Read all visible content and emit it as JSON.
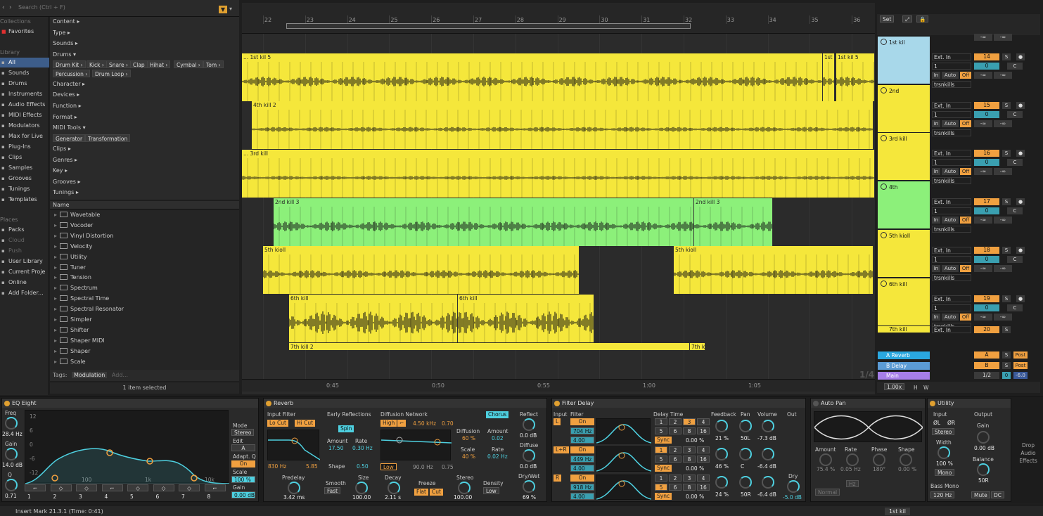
{
  "browser": {
    "search_placeholder": "Search (Ctrl + F)",
    "collections_header": "Collections",
    "favorites": "Favorites",
    "library_header": "Library",
    "library": [
      "All",
      "Sounds",
      "Drums",
      "Instruments",
      "Audio Effects",
      "MIDI Effects",
      "Modulators",
      "Max for Live",
      "Plug-Ins",
      "Clips",
      "Samples",
      "Grooves",
      "Tunings",
      "Templates"
    ],
    "places_header": "Places",
    "places": [
      "Packs",
      "Cloud",
      "Push",
      "User Library",
      "Current Proje",
      "Online",
      "Add Folder..."
    ],
    "filters": {
      "content": "Content ▸",
      "type": "Type ▸",
      "sounds": "Sounds ▸",
      "drums": "Drums ▾",
      "drum_chips": [
        "Drum Kit ›",
        "Kick ›",
        "Snare ›",
        "Clap",
        "Hihat ›",
        "Cymbal ›",
        "Tom ›"
      ],
      "drum_chips2": [
        "Percussion ›",
        "Drum Loop ›"
      ],
      "character": "Character ▸",
      "devices": "Devices ▸",
      "function": "Function ▸",
      "format": "Format ▸",
      "midi_tools": "MIDI Tools ▾",
      "midi_chips": [
        "Generator",
        "Transformation"
      ],
      "clips": "Clips ▸",
      "genres": "Genres ▸",
      "key": "Key ▸",
      "grooves": "Grooves ▸",
      "tunings": "Tunings ▸"
    },
    "list_header": "Name",
    "files": [
      "Wavetable",
      "Vocoder",
      "Vinyl Distortion",
      "Velocity",
      "Utility",
      "Tuner",
      "Tension",
      "Spectrum",
      "Spectral Time",
      "Spectral Resonator",
      "Simpler",
      "Shifter",
      "Shaper MIDI",
      "Shaper",
      "Scale"
    ],
    "tags_label": "Tags:",
    "tag_chip": "Modulation",
    "tag_add": "Add...",
    "status": "1 item selected"
  },
  "arrangement": {
    "bars": [
      "22",
      "23",
      "24",
      "25",
      "26",
      "27",
      "28",
      "29",
      "30",
      "31",
      "32",
      "33",
      "34",
      "35",
      "36"
    ],
    "timeline": [
      "0:45",
      "0:50",
      "0:55",
      "1:00",
      "1:05"
    ],
    "fraction": "1/4",
    "clips": [
      {
        "name": "... 1st kil 5",
        "color": "#f5e73b"
      },
      {
        "name": "1st k",
        "color": "#f5e73b"
      },
      {
        "name": "1st kil 5",
        "color": "#f5e73b"
      },
      {
        "name": "4th kill 2",
        "color": "#f5e73b"
      },
      {
        "name": "... 3rd kill",
        "color": "#f5e73b"
      },
      {
        "name": "2nd kill 3",
        "color": "#8cf07a"
      },
      {
        "name": "2nd kill 3",
        "color": "#8cf07a"
      },
      {
        "name": "5th kioll",
        "color": "#f5e73b"
      },
      {
        "name": "5th kioll",
        "color": "#f5e73b"
      },
      {
        "name": "6th kill",
        "color": "#f5e73b"
      },
      {
        "name": "6th kill",
        "color": "#f5e73b"
      },
      {
        "name": "7th kill 2",
        "color": "#f5e73b"
      },
      {
        "name": "7th k",
        "color": "#f5e73b"
      }
    ]
  },
  "session": {
    "set_label": "Set",
    "zoom": "1.00x",
    "h_label": "H",
    "w_label": "W",
    "tracks": [
      {
        "name": "1st kil",
        "input": "Ext. In",
        "channel": "1",
        "num": "14",
        "s": "S",
        "c": "C",
        "vol": "0",
        "in": "In",
        "auto": "Auto",
        "off": "Off",
        "group": "trsnkills",
        "color": "#a8d8ea"
      },
      {
        "name": "2nd",
        "input": "Ext. In",
        "channel": "1",
        "num": "15",
        "s": "S",
        "c": "C",
        "vol": "0",
        "in": "In",
        "auto": "Auto",
        "off": "Off",
        "group": "trsnkills",
        "color": "#f5e73b"
      },
      {
        "name": "3rd kill",
        "input": "Ext. In",
        "channel": "1",
        "num": "16",
        "s": "S",
        "c": "C",
        "vol": "0",
        "in": "In",
        "auto": "Auto",
        "off": "Off",
        "group": "trsnkills",
        "color": "#f5e73b"
      },
      {
        "name": "4th",
        "input": "Ext. In",
        "channel": "1",
        "num": "17",
        "s": "S",
        "c": "C",
        "vol": "0",
        "in": "In",
        "auto": "Auto",
        "off": "Off",
        "group": "trsnkills",
        "color": "#8cf07a"
      },
      {
        "name": "5th kioll",
        "input": "Ext. In",
        "channel": "1",
        "num": "18",
        "s": "S",
        "c": "C",
        "vol": "0",
        "in": "In",
        "auto": "Auto",
        "off": "Off",
        "group": "trsnkills",
        "color": "#f5e73b"
      },
      {
        "name": "6th kill",
        "input": "Ext. In",
        "channel": "1",
        "num": "19",
        "s": "S",
        "c": "C",
        "vol": "0",
        "in": "In",
        "auto": "Auto",
        "off": "Off",
        "group": "trsnkills",
        "color": "#f5e73b"
      }
    ],
    "track7": {
      "name": "7th kill",
      "input": "Ext. In",
      "num": "20",
      "s": "S"
    },
    "inf": "-∞",
    "returns": [
      {
        "name": "A Reverb",
        "letter": "A",
        "s": "S",
        "post": "Post",
        "color": "#2aa8e0"
      },
      {
        "name": "B Delay",
        "letter": "B",
        "s": "S",
        "post": "Post",
        "color": "#5b9bd5"
      },
      {
        "name": "Main",
        "letter": "1/2",
        "s": "0",
        "post": "-6.0",
        "color": "#a67ee8"
      }
    ]
  },
  "devices": {
    "eq": {
      "title": "EQ Eight",
      "freq_label": "Freq",
      "freq": "28.4 Hz",
      "gain_label": "Gain",
      "gain": "14.0 dB",
      "q_label": "Q",
      "q": "0.71",
      "db_ticks": [
        "12",
        "6",
        "0",
        "-6",
        "-12"
      ],
      "freq_ticks": [
        "100",
        "1k",
        "10k"
      ],
      "bands": [
        "1",
        "2",
        "3",
        "4",
        "5",
        "6",
        "7",
        "8"
      ],
      "mode_label": "Mode",
      "mode": "Stereo",
      "edit_label": "Edit",
      "edit": "A",
      "adapt_label": "Adapt. Q",
      "adapt": "On",
      "scale_label": "Scale",
      "scale": "100 %",
      "gain2_label": "Gain",
      "gain2": "0.00 dB"
    },
    "reverb": {
      "title": "Reverb",
      "input_filter": "Input Filter",
      "lo_cut": "Lo Cut",
      "hi_cut": "Hi Cut",
      "in_freq": "830 Hz",
      "in_q": "5.85",
      "early": "Early Reflections",
      "spin": "Spin",
      "amount_label": "Amount",
      "amount": "17.50",
      "rate_label": "Rate",
      "rate": "0.30 Hz",
      "shape_label": "Shape",
      "shape": "0.50",
      "diffusion": "Diffusion Network",
      "high": "High",
      "high_freq": "4.50 kHz",
      "high_val": "0.70",
      "low": "Low",
      "low_freq": "90.0 Hz",
      "low_val": "0.75",
      "diff_label": "Diffusion",
      "diff": "60 %",
      "scale_label": "Scale",
      "scale": "40 %",
      "chorus": "Chorus",
      "ch_amount_label": "Amount",
      "ch_amount": "0.02",
      "ch_rate_label": "Rate",
      "ch_rate": "0.02 Hz",
      "reflect_label": "Reflect",
      "reflect": "0.0 dB",
      "diffuse_label": "Diffuse",
      "diffuse": "0.0 dB",
      "drywet_label": "Dry/Wet",
      "drywet": "69 %",
      "predelay_label": "Predelay",
      "predelay": "3.42 ms",
      "smooth_label": "Smooth",
      "smooth": "Fast",
      "size_label": "Size",
      "size": "100.00",
      "decay_label": "Decay",
      "decay": "2.11 s",
      "freeze_label": "Freeze",
      "flat": "Flat",
      "cut": "Cut",
      "stereo_label": "Stereo",
      "stereo": "100.00",
      "density_label": "Density",
      "density": "Low"
    },
    "filterdelay": {
      "title": "Filter Delay",
      "input": "Input",
      "filter": "Filter",
      "delay_time": "Delay Time",
      "feedback": "Feedback",
      "pan": "Pan",
      "volume": "Volume",
      "out": "Out",
      "rows": [
        {
          "ch": "L",
          "on": "On",
          "freq": "704 Hz",
          "q": "4.00",
          "sync": "Sync",
          "pct": "0.00 %",
          "fb": "21 %",
          "pan": "50L",
          "vol": "-7.3 dB"
        },
        {
          "ch": "L+R",
          "on": "On",
          "freq": "449 Hz",
          "q": "4.00",
          "sync": "Sync",
          "pct": "0.00 %",
          "fb": "46 %",
          "pan": "C",
          "vol": "-6.4 dB"
        },
        {
          "ch": "R",
          "on": "On",
          "freq": "918 Hz",
          "q": "4.00",
          "sync": "Sync",
          "pct": "0.00 %",
          "fb": "24 %",
          "pan": "50R",
          "vol": "-6.4 dB"
        }
      ],
      "delay_nums": [
        "1",
        "2",
        "3",
        "4",
        "5",
        "6",
        "8",
        "16"
      ],
      "dry_label": "Dry",
      "dry": "-5.0 dB"
    },
    "autopan": {
      "title": "Auto Pan",
      "amount_label": "Amount",
      "amount": "75.4 %",
      "rate_label": "Rate",
      "rate": "0.05 Hz",
      "phase_label": "Phase",
      "phase": "180°",
      "shape_label": "Shape",
      "shape": "0.00 %",
      "normal": "Normal",
      "hz": "Hz"
    },
    "utility": {
      "title": "Utility",
      "input_label": "Input",
      "output_label": "Output",
      "ol": "ØL",
      "or": "ØR",
      "mode": "Stereo",
      "gain_label": "Gain",
      "gain": "0.00 dB",
      "width_label": "Width",
      "width": "100 %",
      "mono": "Mono",
      "balance_label": "Balance",
      "balance": "50R",
      "bassmono": "Bass Mono",
      "bassfreq": "120 Hz",
      "mute": "Mute",
      "dc": "DC"
    },
    "drop": "Drop Audio Effects"
  },
  "status": {
    "text": "Insert Mark 21.3.1 (Time: 0:41)",
    "track": "1st kil"
  }
}
